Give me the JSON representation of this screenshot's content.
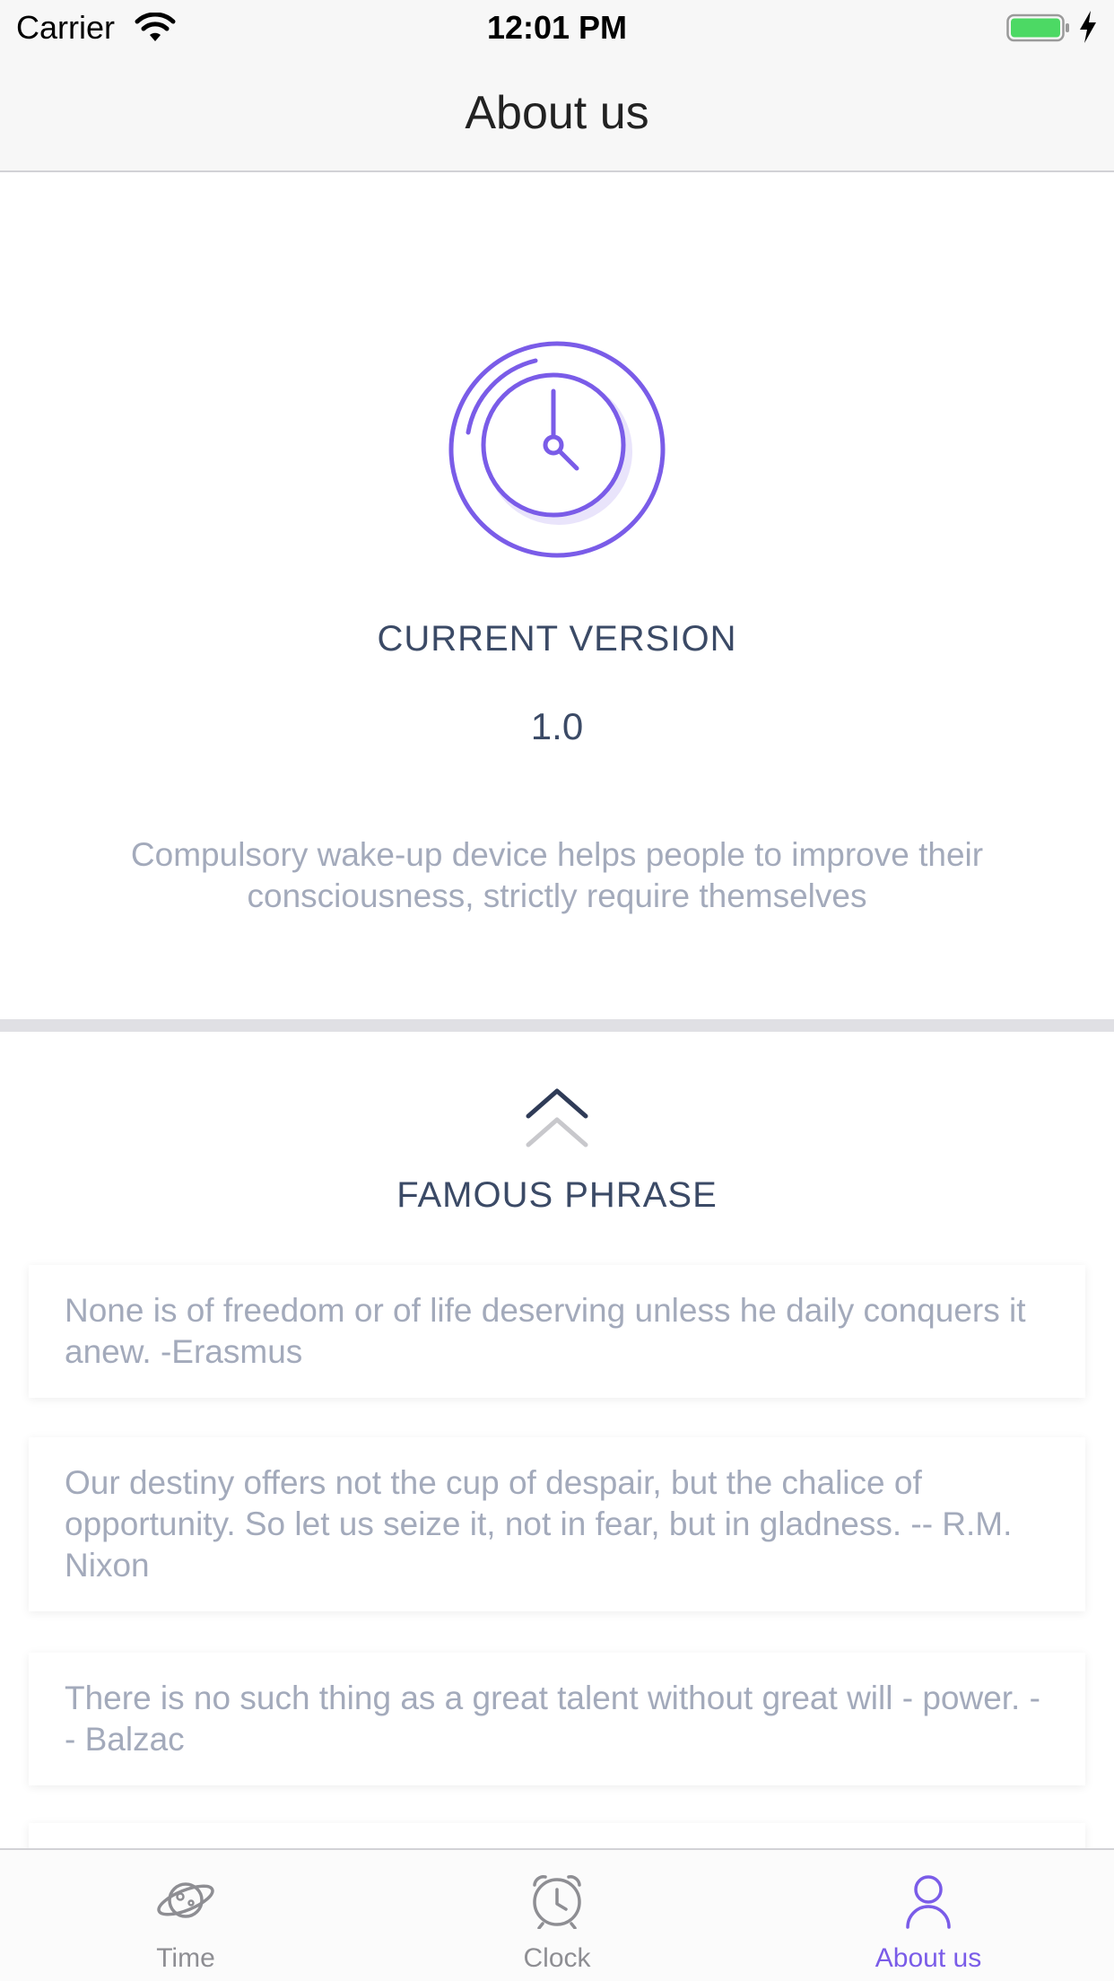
{
  "status_bar": {
    "carrier": "Carrier",
    "time": "12:01 PM",
    "wifi_icon": "wifi-icon",
    "battery_icon": "battery-icon",
    "charging_icon": "charging-bolt-icon"
  },
  "nav": {
    "title": "About us"
  },
  "about": {
    "logo_icon": "clock-logo-icon",
    "version_label": "CURRENT VERSION",
    "version_value": "1.0",
    "description": "Compulsory wake-up device helps people to improve their consciousness, strictly require themselves"
  },
  "phrases": {
    "chevron_icon": "double-chevron-up-icon",
    "title": "FAMOUS PHRASE",
    "items": [
      "None is of freedom or of life deserving unless he daily conquers it anew. -Erasmus",
      "Our destiny offers not the cup of despair, but the chalice of opportunity. So let us seize it, not in fear, but in gladness. -- R.M. Nixon",
      "There is no such thing as a great talent without great will - power. -- Balzac",
      ""
    ]
  },
  "tabs": [
    {
      "label": "Time",
      "icon": "planet-icon",
      "active": false
    },
    {
      "label": "Clock",
      "icon": "alarm-clock-icon",
      "active": false
    },
    {
      "label": "About us",
      "icon": "person-icon",
      "active": true
    }
  ],
  "colors": {
    "accent": "#7a5ce8",
    "heading": "#3b4a66",
    "muted_text": "#a3aabb",
    "tab_inactive": "#8e8e93",
    "battery": "#4cd964"
  }
}
